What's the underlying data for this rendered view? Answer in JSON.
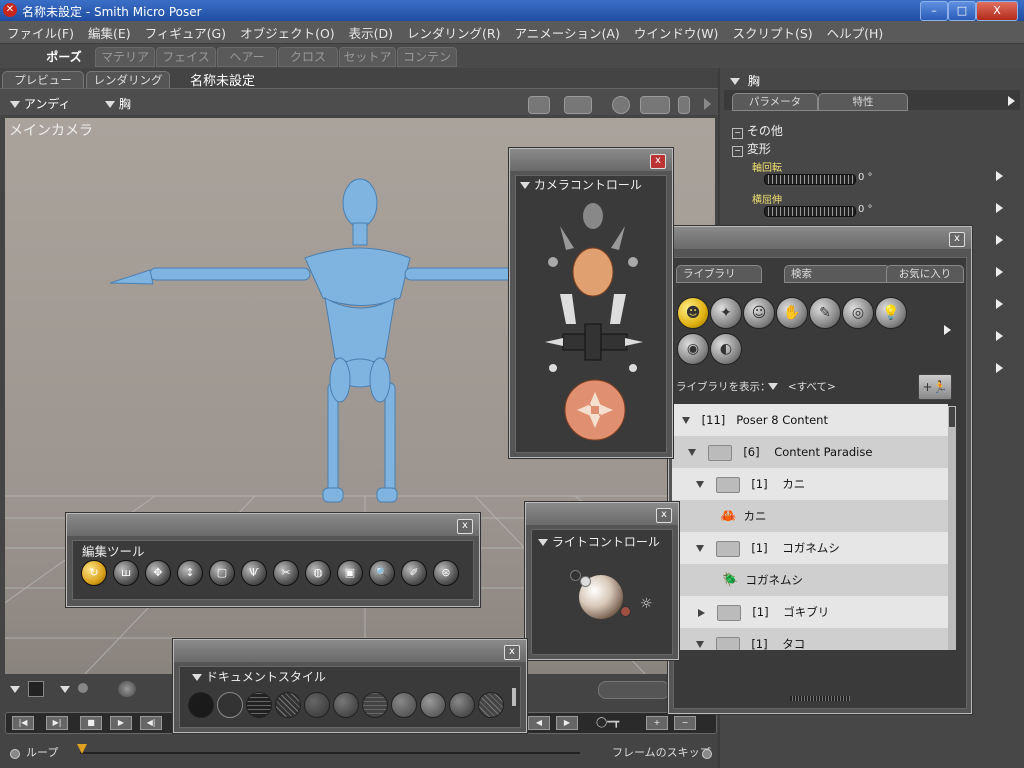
{
  "window": {
    "title": "名称未設定 - Smith Micro Poser",
    "minimize": "–",
    "maximize": "□",
    "close": "X"
  },
  "menu": [
    "ファイル(F)",
    "編集(E)",
    "フィギュア(G)",
    "オブジェクト(O)",
    "表示(D)",
    "レンダリング(R)",
    "アニメーション(A)",
    "ウインドウ(W)",
    "スクリプト(S)",
    "ヘルプ(H)"
  ],
  "rooms": [
    "ポーズ",
    "マテリアル",
    "フェイス",
    "ヘアー",
    "クロス",
    "セットアップ",
    "コンテンツ"
  ],
  "viewtabs": {
    "preview": "プレビュー",
    "render": "レンダリング",
    "doc_title": "名称未設定"
  },
  "selectors": {
    "figure": "アンディ",
    "part": "胸"
  },
  "viewport": {
    "camera_label": "メインカメラ"
  },
  "params": {
    "actor": "胸",
    "tab_params": "パラメータ",
    "tab_props": "特性",
    "group_other": "その他",
    "group_transform": "変形",
    "twist_label": "軸回転",
    "twist_value": "0 °",
    "sidesize_label": "横屈伸",
    "sidesize_value": "0 °"
  },
  "camera_window": {
    "title": "カメラコントロール",
    "close": "x"
  },
  "library": {
    "close": "x",
    "tab_library": "ライブラリ",
    "tab_search": "検索",
    "tab_favorites": "お気に入り",
    "show_label": "ライブラリを表示：",
    "show_value": "<すべて>",
    "tree": [
      {
        "count": "[11]",
        "name": "Poser 8 Content"
      },
      {
        "count": "[6]",
        "name": "Content Paradise"
      },
      {
        "count": "[1]",
        "name": "カニ"
      },
      {
        "item": "カニ"
      },
      {
        "count": "[1]",
        "name": "コガネムシ"
      },
      {
        "item": "コガネムシ"
      },
      {
        "count": "[1]",
        "name": "ゴキブリ"
      },
      {
        "count": "[1]",
        "name": "タコ"
      }
    ]
  },
  "edit_tools": {
    "title": "編集ツール",
    "close": "x"
  },
  "light_window": {
    "title": "ライトコントロール",
    "close": "x"
  },
  "doc_style": {
    "title": "ドキュメントスタイル",
    "close": "x"
  },
  "bottom": {
    "loop": "ループ",
    "skip_frames": "フレームのスキップ"
  }
}
